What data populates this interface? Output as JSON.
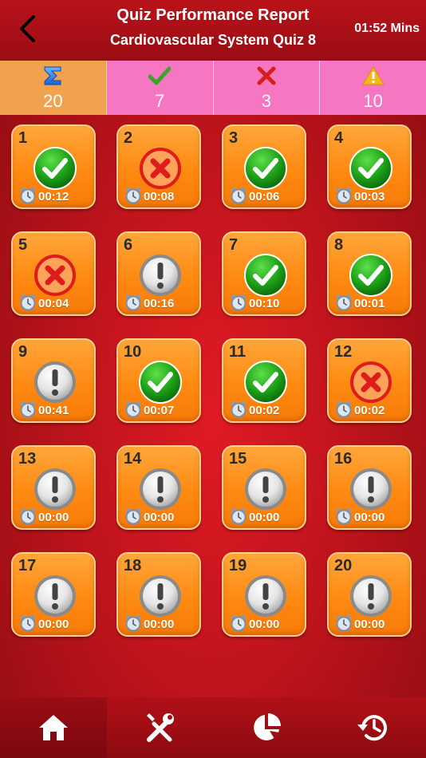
{
  "header": {
    "title": "Quiz Performance Report",
    "subtitle": "Cardiovascular System Quiz 8",
    "timer": "01:52 Mins"
  },
  "stats": {
    "total": "20",
    "correct": "7",
    "wrong": "3",
    "skipped": "10"
  },
  "questions": [
    {
      "number": "1",
      "status": "correct",
      "time": "00:12"
    },
    {
      "number": "2",
      "status": "wrong",
      "time": "00:08"
    },
    {
      "number": "3",
      "status": "correct",
      "time": "00:06"
    },
    {
      "number": "4",
      "status": "correct",
      "time": "00:03"
    },
    {
      "number": "5",
      "status": "wrong",
      "time": "00:04"
    },
    {
      "number": "6",
      "status": "skipped",
      "time": "00:16"
    },
    {
      "number": "7",
      "status": "correct",
      "time": "00:10"
    },
    {
      "number": "8",
      "status": "correct",
      "time": "00:01"
    },
    {
      "number": "9",
      "status": "skipped",
      "time": "00:41"
    },
    {
      "number": "10",
      "status": "correct",
      "time": "00:07"
    },
    {
      "number": "11",
      "status": "correct",
      "time": "00:02"
    },
    {
      "number": "12",
      "status": "wrong",
      "time": "00:02"
    },
    {
      "number": "13",
      "status": "skipped",
      "time": "00:00"
    },
    {
      "number": "14",
      "status": "skipped",
      "time": "00:00"
    },
    {
      "number": "15",
      "status": "skipped",
      "time": "00:00"
    },
    {
      "number": "16",
      "status": "skipped",
      "time": "00:00"
    },
    {
      "number": "17",
      "status": "skipped",
      "time": "00:00"
    },
    {
      "number": "18",
      "status": "skipped",
      "time": "00:00"
    },
    {
      "number": "19",
      "status": "skipped",
      "time": "00:00"
    },
    {
      "number": "20",
      "status": "skipped",
      "time": "00:00"
    }
  ],
  "tabbar": {
    "items": [
      {
        "icon": "home-icon",
        "active": true
      },
      {
        "icon": "tools-icon",
        "active": false
      },
      {
        "icon": "pie-chart-icon",
        "active": false
      },
      {
        "icon": "history-icon",
        "active": false
      }
    ]
  },
  "colors": {
    "header": "#b9121a",
    "total_bg": "#f0a24e",
    "stat_bg": "#f776c2",
    "tile": "#ff8a12",
    "correct": "#1aa01a",
    "wrong": "#e8191c"
  }
}
